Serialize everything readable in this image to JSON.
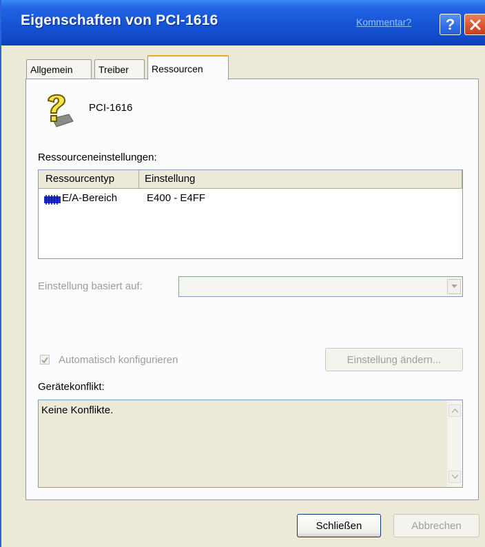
{
  "window": {
    "title": "Eigenschaften von PCI-1616",
    "kommentar_link": "Kommentar?",
    "help_glyph": "?",
    "title_color": "#1553d6"
  },
  "tabs": [
    {
      "label": "Allgemein",
      "active": false
    },
    {
      "label": "Treiber",
      "active": false
    },
    {
      "label": "Ressourcen",
      "active": true
    }
  ],
  "device": {
    "name": "PCI-1616",
    "icon": "unknown-device-question-icon"
  },
  "resources": {
    "section_label": "Ressourceneinstellungen:",
    "columns": [
      "Ressourcentyp",
      "Einstellung"
    ],
    "rows": [
      {
        "type": "E/A-Bereich",
        "setting": "E400 - E4FF",
        "icon": "io-range-icon"
      }
    ]
  },
  "based_on": {
    "label": "Einstellung basiert auf:",
    "value": ""
  },
  "auto_config": {
    "label": "Automatisch konfigurieren",
    "checked": true,
    "disabled": true
  },
  "buttons": {
    "change_setting": "Einstellung ändern...",
    "close": "Schließen",
    "cancel": "Abbrechen"
  },
  "conflict": {
    "label": "Gerätekonflikt:",
    "text": "Keine Konflikte."
  }
}
